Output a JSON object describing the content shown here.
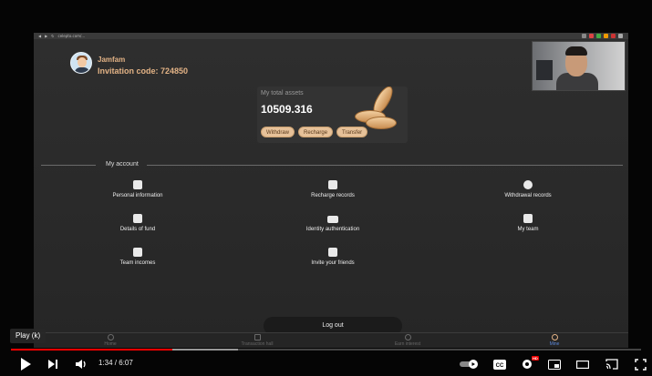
{
  "browser": {
    "url": "celepto.com/..."
  },
  "user": {
    "name": "Jamfam",
    "invitation": "Invitation code: 724850"
  },
  "assets": {
    "label": "My total assets",
    "value": "10509.316",
    "buttons": [
      "Withdraw",
      "Recharge",
      "Transfer"
    ]
  },
  "account": {
    "title": "My account",
    "items": [
      {
        "label": "Personal information",
        "icon": "person-card-icon"
      },
      {
        "label": "Recharge records",
        "icon": "wallet-icon"
      },
      {
        "label": "Withdrawal records",
        "icon": "user-coin-icon"
      },
      {
        "label": "Details of fund",
        "icon": "document-dollar-icon"
      },
      {
        "label": "Identity authentication",
        "icon": "id-card-icon"
      },
      {
        "label": "My team",
        "icon": "team-doc-icon"
      },
      {
        "label": "Team incomes",
        "icon": "chart-up-icon"
      },
      {
        "label": "Invite your friends",
        "icon": "envelope-icon"
      }
    ]
  },
  "logout": "Log out",
  "nav": [
    {
      "label": "Home",
      "active": false
    },
    {
      "label": "Transaction hall",
      "active": false
    },
    {
      "label": "Earn interest",
      "active": false
    },
    {
      "label": "Mine",
      "active": true
    }
  ],
  "player": {
    "tooltip": "Play (k)",
    "time": "1:34 / 6:07",
    "progress_played": 0.256,
    "progress_buffered": 0.36,
    "hd_badge": "HD"
  },
  "colors": {
    "accent": "#e2b285",
    "active_nav": "#5b86d6",
    "progress": "#ff0000"
  }
}
